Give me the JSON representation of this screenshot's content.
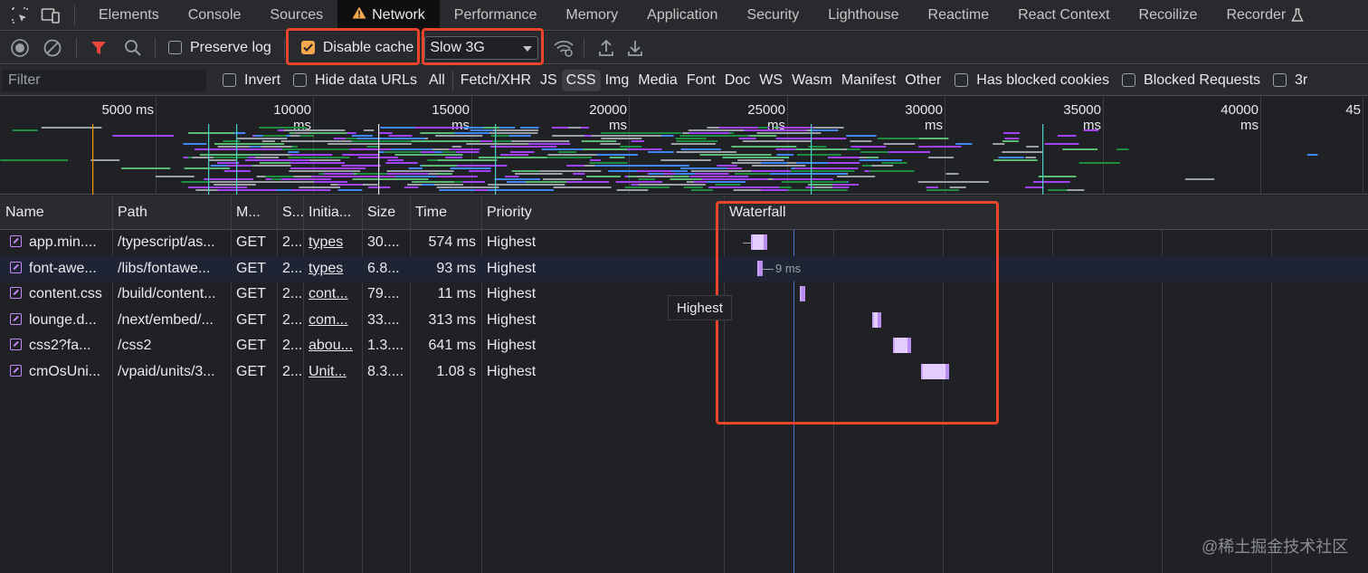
{
  "tabs": [
    "Elements",
    "Console",
    "Sources",
    "Network",
    "Performance",
    "Memory",
    "Application",
    "Security",
    "Lighthouse",
    "Reactime",
    "React Context",
    "Recoilize",
    "Recorder"
  ],
  "active_tab": "Network",
  "toolbar": {
    "preserve_log": "Preserve log",
    "disable_cache": "Disable cache",
    "disable_cache_checked": true,
    "throttling": "Slow 3G"
  },
  "filter": {
    "placeholder": "Filter",
    "invert": "Invert",
    "hide_data_urls": "Hide data URLs",
    "types": [
      "All",
      "Fetch/XHR",
      "JS",
      "CSS",
      "Img",
      "Media",
      "Font",
      "Doc",
      "WS",
      "Wasm",
      "Manifest",
      "Other"
    ],
    "active_type": "CSS",
    "has_blocked_cookies": "Has blocked cookies",
    "blocked_requests": "Blocked Requests",
    "third_party_partial": "3r"
  },
  "overview": {
    "ticks": [
      "5000 ms",
      "10000 ms",
      "15000 ms",
      "20000 ms",
      "25000 ms",
      "30000 ms",
      "35000 ms",
      "40000 ms",
      "45"
    ]
  },
  "columns": [
    "Name",
    "Path",
    "M...",
    "S...",
    "Initia...",
    "Size",
    "Time",
    "Priority",
    "Waterfall"
  ],
  "rows": [
    {
      "name": "app.min....",
      "path": "/typescript/as...",
      "method": "GET",
      "status": "2...",
      "initiator": "types",
      "size": "30....",
      "time": "574 ms",
      "priority": "Highest"
    },
    {
      "name": "font-awe...",
      "path": "/libs/fontawe...",
      "method": "GET",
      "status": "2...",
      "initiator": "types",
      "size": "6.8...",
      "time": "93 ms",
      "priority": "Highest"
    },
    {
      "name": "content.css",
      "path": "/build/content...",
      "method": "GET",
      "status": "2...",
      "initiator": "cont...",
      "size": "79....",
      "time": "11 ms",
      "priority": "Highest"
    },
    {
      "name": "lounge.d...",
      "path": "/next/embed/...",
      "method": "GET",
      "status": "2...",
      "initiator": "com...",
      "size": "33....",
      "time": "313 ms",
      "priority": "Highest"
    },
    {
      "name": "css2?fa...",
      "path": "/css2",
      "method": "GET",
      "status": "2...",
      "initiator": "abou...",
      "size": "1.3....",
      "time": "641 ms",
      "priority": "Highest"
    },
    {
      "name": "cmOsUni...",
      "path": "/vpaid/units/3...",
      "method": "GET",
      "status": "2...",
      "initiator": "Unit...",
      "size": "8.3....",
      "time": "1.08 s",
      "priority": "Highest"
    }
  ],
  "waterfall_hover_label": "9 ms",
  "tooltip": "Highest",
  "watermark": "@稀土掘金技术社区"
}
